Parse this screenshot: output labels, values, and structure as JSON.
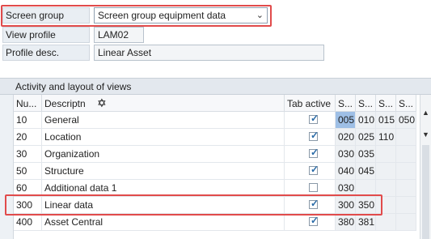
{
  "header": {
    "screen_group_label": "Screen group",
    "screen_group_value": "Screen group equipment data",
    "view_profile_label": "View profile",
    "view_profile_value": "LAM02",
    "profile_desc_label": "Profile desc.",
    "profile_desc_value": "Linear Asset"
  },
  "table": {
    "title": "Activity and layout of views",
    "columns": [
      "Nu...",
      "Descriptn",
      "Tab active",
      "S...",
      "S...",
      "S...",
      "S..."
    ],
    "rows": [
      {
        "num": "10",
        "desc": "General",
        "tab_active": true,
        "s": [
          "005",
          "010",
          "015",
          "050"
        ]
      },
      {
        "num": "20",
        "desc": "Location",
        "tab_active": true,
        "s": [
          "020",
          "025",
          "110",
          ""
        ]
      },
      {
        "num": "30",
        "desc": "Organization",
        "tab_active": true,
        "s": [
          "030",
          "035",
          "",
          ""
        ]
      },
      {
        "num": "50",
        "desc": "Structure",
        "tab_active": true,
        "s": [
          "040",
          "045",
          "",
          ""
        ]
      },
      {
        "num": "60",
        "desc": "Additional data 1",
        "tab_active": false,
        "s": [
          "030",
          "",
          "",
          ""
        ]
      },
      {
        "num": "300",
        "desc": "Linear data",
        "tab_active": true,
        "s": [
          "300",
          "350",
          "",
          ""
        ]
      },
      {
        "num": "400",
        "desc": "Asset Central",
        "tab_active": true,
        "s": [
          "380",
          "381",
          "",
          ""
        ]
      }
    ]
  },
  "colors": {
    "highlight": "#e14b4b",
    "selected_cell": "#9ebfe6"
  },
  "icons": [
    "chevron-down-icon",
    "checkbox-checked-icon",
    "table-settings-icon",
    "move-cursor-icon",
    "scroll-up-icon",
    "scroll-down-icon"
  ]
}
